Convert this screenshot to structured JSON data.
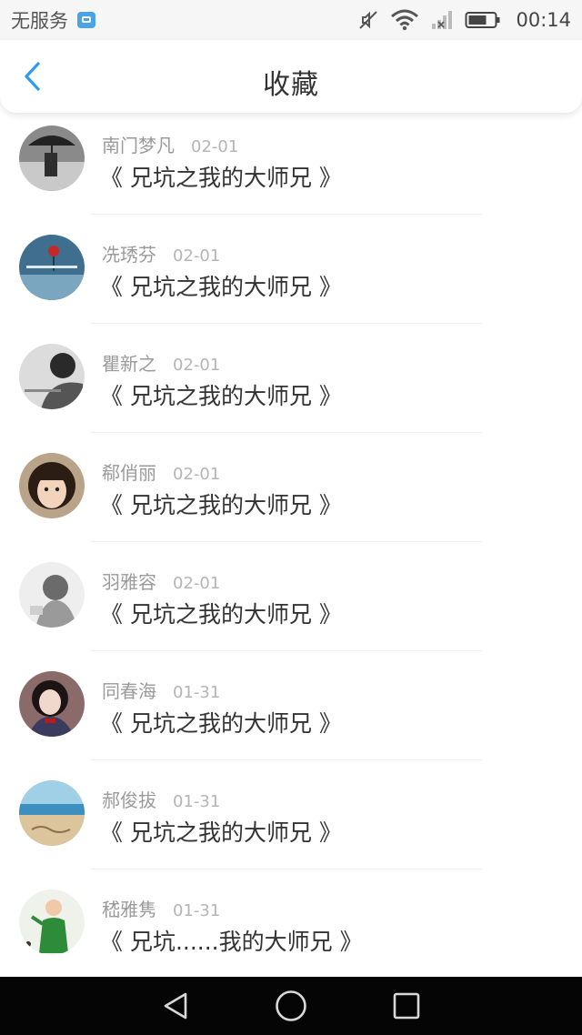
{
  "status_bar": {
    "carrier": "无服务",
    "time": "00:14",
    "icons": [
      "app-notification-icon",
      "mute-icon",
      "wifi-icon",
      "signal-icon",
      "battery-icon"
    ]
  },
  "header": {
    "title": "收藏",
    "back_icon": "chevron-left-icon",
    "accent_color": "#2d9bf0"
  },
  "favorites": [
    {
      "author": "南门梦凡",
      "date": "02-01",
      "book": "《 兄坑之我的大师兄 》",
      "avatar": "avatar-umbrella"
    },
    {
      "author": "冼琇芬",
      "date": "02-01",
      "book": "《 兄坑之我的大师兄 》",
      "avatar": "avatar-blue-flower"
    },
    {
      "author": "瞿新之",
      "date": "02-01",
      "book": "《 兄坑之我的大师兄 》",
      "avatar": "avatar-bw-portrait"
    },
    {
      "author": "郗俏丽",
      "date": "02-01",
      "book": "《 兄坑之我的大师兄 》",
      "avatar": "avatar-girl"
    },
    {
      "author": "羽雅容",
      "date": "02-01",
      "book": "《 兄坑之我的大师兄 》",
      "avatar": "avatar-grey-sketch"
    },
    {
      "author": "同春海",
      "date": "01-31",
      "book": "《 兄坑之我的大师兄 》",
      "avatar": "avatar-uniform-girl"
    },
    {
      "author": "郝俊拔",
      "date": "01-31",
      "book": "《 兄坑之我的大师兄 》",
      "avatar": "avatar-beach"
    },
    {
      "author": "嵇雅隽",
      "date": "01-31",
      "book": "《 兄坑......我的大师兄 》",
      "avatar": "avatar-green-figure"
    }
  ],
  "nav_bar": {
    "back_icon": "triangle-back-icon",
    "home_icon": "circle-home-icon",
    "recents_icon": "square-recents-icon"
  }
}
